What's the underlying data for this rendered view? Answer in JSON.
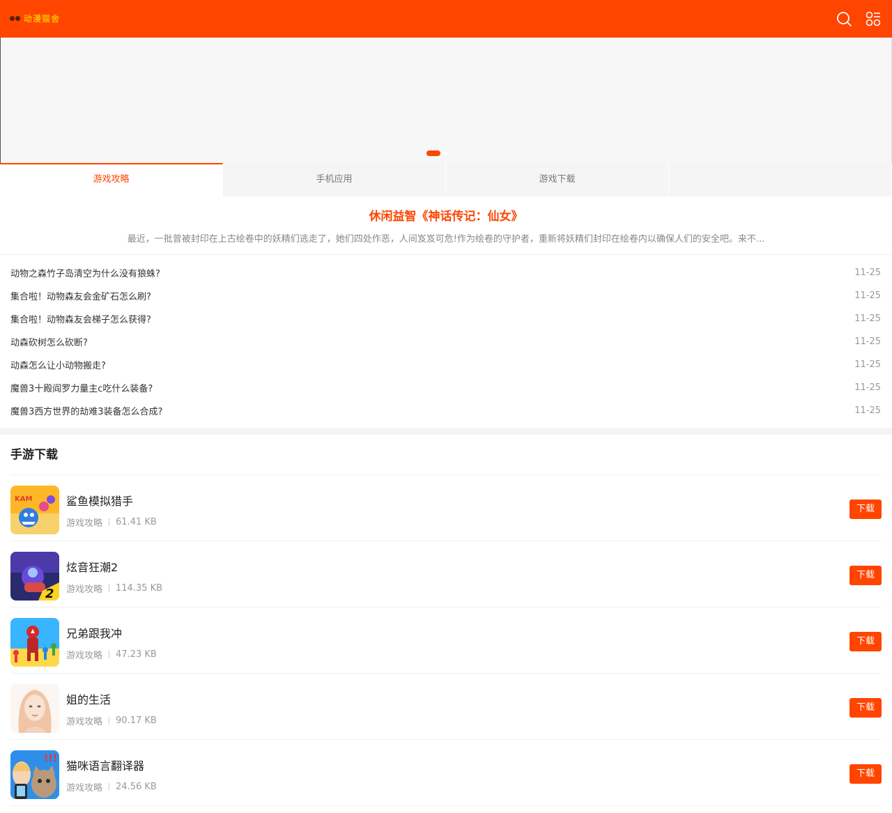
{
  "header": {
    "logo_text": "动漫猫舍",
    "brand_color": "#ff4500",
    "icons": [
      "search-icon",
      "menu-icon"
    ]
  },
  "tabs": [
    {
      "label": "游戏攻略",
      "active": true
    },
    {
      "label": "手机应用",
      "active": false
    },
    {
      "label": "游戏下载",
      "active": false
    }
  ],
  "feature": {
    "title": "休闲益智《神话传记：仙女》",
    "desc": "最近，一批曾被封印在上古绘卷中的妖精们逃走了，她们四处作恶，人间岌岌可危!作为绘卷的守护者，重新将妖精们封印在绘卷内以确保人们的安全吧。来不..."
  },
  "news": [
    {
      "title": "动物之森竹子岛清空为什么没有狼蛛?",
      "date": "11-25"
    },
    {
      "title": "集合啦！动物森友会金矿石怎么刷?",
      "date": "11-25"
    },
    {
      "title": "集合啦！动物森友会梯子怎么获得?",
      "date": "11-25"
    },
    {
      "title": "动森砍树怎么砍断?",
      "date": "11-25"
    },
    {
      "title": "动森怎么让小动物搬走?",
      "date": "11-25"
    },
    {
      "title": "魔兽3十殿阎罗力量主c吃什么装备?",
      "date": "11-25"
    },
    {
      "title": "魔兽3西方世界的劫难3装备怎么合成?",
      "date": "11-25"
    }
  ],
  "section": {
    "title": "手游下载",
    "download_label": "下载",
    "apps": [
      {
        "name": "鲨鱼模拟猎手",
        "category": "游戏攻略",
        "size": "61.41 KB",
        "icon": "shark-game-icon"
      },
      {
        "name": "炫音狂潮2",
        "category": "游戏攻略",
        "size": "114.35 KB",
        "icon": "music-game-icon"
      },
      {
        "name": "兄弟跟我冲",
        "category": "游戏攻略",
        "size": "47.23 KB",
        "icon": "runner-game-icon"
      },
      {
        "name": "姐的生活",
        "category": "游戏攻略",
        "size": "90.17 KB",
        "icon": "portrait-game-icon"
      },
      {
        "name": "猫咪语言翻译器",
        "category": "游戏攻略",
        "size": "24.56 KB",
        "icon": "cat-translator-icon"
      }
    ]
  }
}
